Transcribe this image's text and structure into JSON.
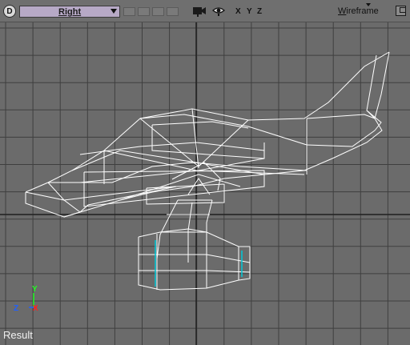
{
  "toolbar": {
    "view_menu_icon": "d-badge",
    "view_label": "Right",
    "axes": {
      "x": "X",
      "y": "Y",
      "z": "Z"
    },
    "shading_label": "Wireframe",
    "icons": [
      "camera-icon",
      "eye-icon",
      "maximize-icon",
      "dropdown-arrow-icon"
    ]
  },
  "viewport": {
    "axis_labels": {
      "y": "Y",
      "z": "Z",
      "x": "X"
    },
    "status_label": "Result"
  },
  "colors": {
    "background": "#6b6b6b",
    "grid": "#3f3f3f",
    "wireframe": "#ffffff",
    "highlight": "#00c8d8",
    "view_dropdown": "#b7a9c6",
    "axis_x": "#ff2020",
    "axis_y": "#20ff20",
    "axis_z": "#2060ff"
  }
}
